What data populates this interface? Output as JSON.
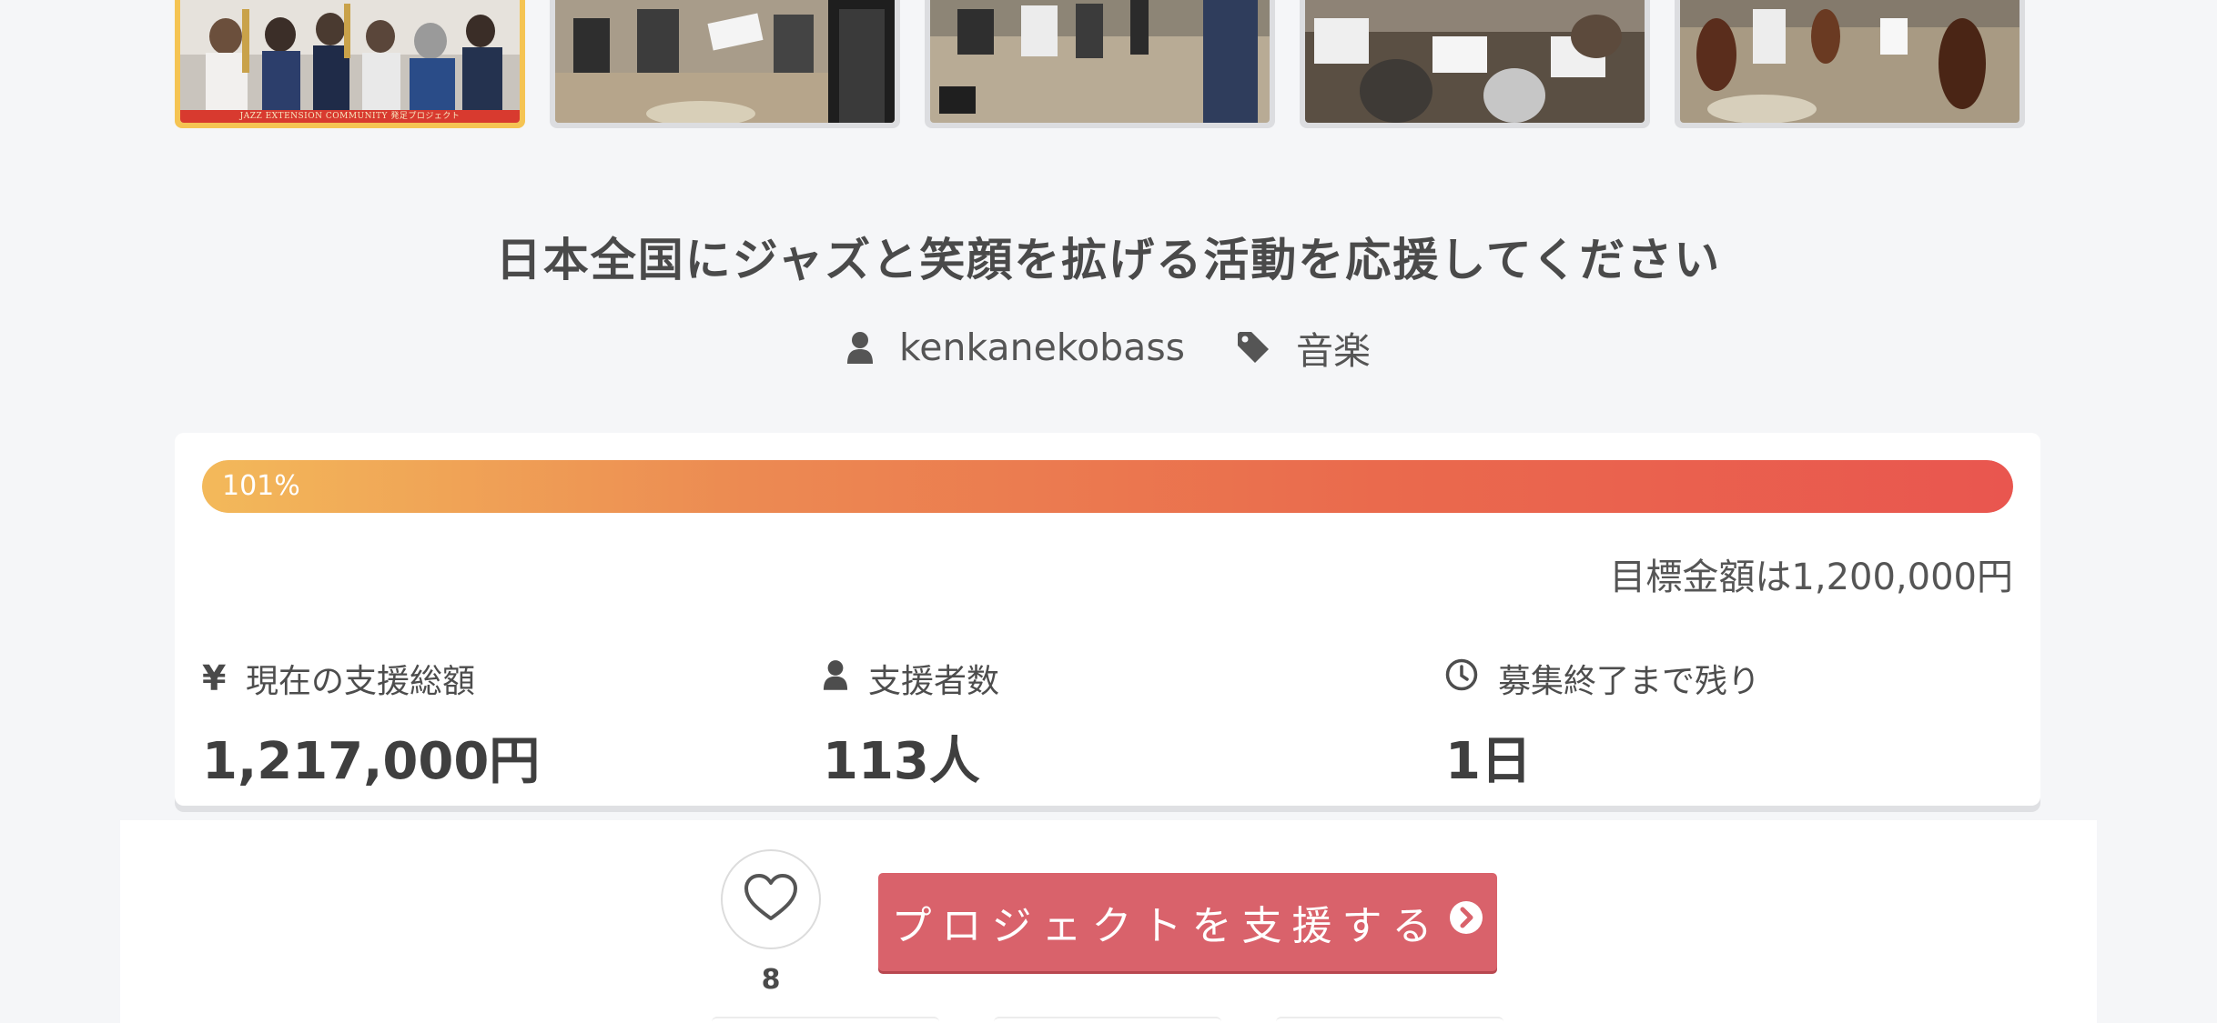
{
  "gallery": {
    "thumbnails": [
      {
        "name": "thumb-group-photo",
        "active": true,
        "caption": "JAZZ EXTENSION COMMUNITY 発足プロジェクト"
      },
      {
        "name": "thumb-rehearsal-horns",
        "active": false
      },
      {
        "name": "thumb-rehearsal-wide",
        "active": false
      },
      {
        "name": "thumb-rehearsal-drums",
        "active": false
      },
      {
        "name": "thumb-rehearsal-bass",
        "active": false
      }
    ]
  },
  "project": {
    "title": "日本全国にジャズと笑顔を拡げる活動を応援してください",
    "author": "kenkanekobass",
    "author_icon": "user-icon",
    "category": "音楽",
    "category_icon": "tag-icon"
  },
  "funding": {
    "progress_percent": 101,
    "progress_label": "101%",
    "goal_text": "目標金額は1,200,000円",
    "stats": {
      "raised": {
        "icon": "yen-icon",
        "icon_glyph": "¥",
        "label": "現在の支援総額",
        "value": "1,217,000円"
      },
      "backers": {
        "icon": "user-icon",
        "label": "支援者数",
        "value": "113人"
      },
      "remaining": {
        "icon": "clock-icon",
        "label": "募集終了まで残り",
        "value": "1日"
      }
    },
    "colors": {
      "progress_start": "#f3b95a",
      "progress_end": "#e9564f"
    }
  },
  "actions": {
    "like_icon": "heart-icon",
    "like_count": "8",
    "support_label": "プロジェクトを支援する",
    "support_icon": "chevron-right-circle-icon",
    "support_color": "#d9626b"
  }
}
